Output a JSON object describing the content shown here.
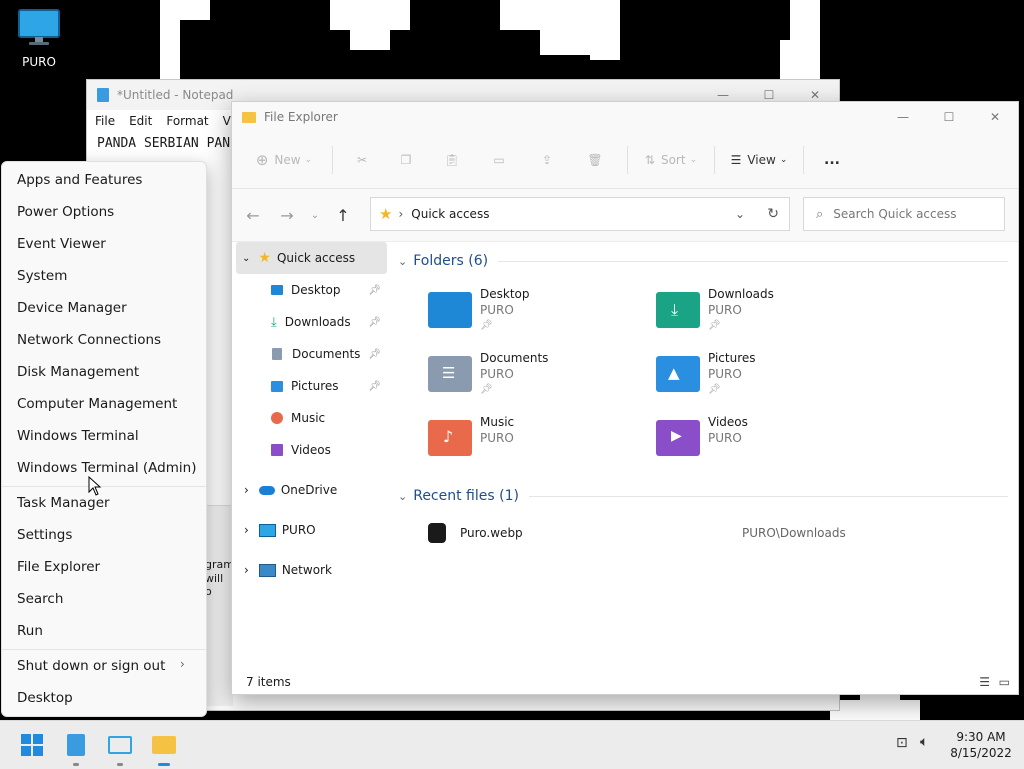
{
  "desktop": {
    "icon_label": "PURO"
  },
  "notepad": {
    "title": "*Untitled - Notepad",
    "menu": [
      "File",
      "Edit",
      "Format",
      "View"
    ],
    "text": "PANDA SERBIAN PAN",
    "behind_text_1": "gram,",
    "behind_text_2": "will o"
  },
  "explorer": {
    "title": "File Explorer",
    "commands": {
      "new": "New",
      "sort": "Sort",
      "view": "View",
      "more": "..."
    },
    "address": "Quick access",
    "search_placeholder": "Search Quick access",
    "nav": {
      "quick_access": "Quick access",
      "items": [
        {
          "label": "Desktop",
          "pinned": true
        },
        {
          "label": "Downloads",
          "pinned": true
        },
        {
          "label": "Documents",
          "pinned": true
        },
        {
          "label": "Pictures",
          "pinned": true
        },
        {
          "label": "Music",
          "pinned": false
        },
        {
          "label": "Videos",
          "pinned": false
        }
      ],
      "onedrive": "OneDrive",
      "puro": "PURO",
      "network": "Network"
    },
    "folders_header": "Folders (6)",
    "folders": [
      {
        "name": "Desktop",
        "location": "PURO",
        "pinned": true,
        "color": "#1e88d6"
      },
      {
        "name": "Downloads",
        "location": "PURO",
        "pinned": true,
        "color": "#1aa384"
      },
      {
        "name": "Documents",
        "location": "PURO",
        "pinned": true,
        "color": "#8a9bb0"
      },
      {
        "name": "Pictures",
        "location": "PURO",
        "pinned": true,
        "color": "#2a8fe0"
      },
      {
        "name": "Music",
        "location": "PURO",
        "pinned": false,
        "color": "#e86a4a"
      },
      {
        "name": "Videos",
        "location": "PURO",
        "pinned": false,
        "color": "#8a4ec8"
      }
    ],
    "recent_header": "Recent files (1)",
    "recent": [
      {
        "name": "Puro.webp",
        "path": "PURO\\Downloads"
      }
    ],
    "status": "7 items"
  },
  "context_menu": {
    "group1": [
      "Apps and Features",
      "Power Options",
      "Event Viewer",
      "System",
      "Device Manager",
      "Network Connections",
      "Disk Management",
      "Computer Management",
      "Windows Terminal",
      "Windows Terminal (Admin)"
    ],
    "group2": [
      "Task Manager",
      "Settings",
      "File Explorer",
      "Search",
      "Run"
    ],
    "group3": [
      "Shut down or sign out",
      "Desktop"
    ]
  },
  "taskbar": {
    "time": "9:30 AM",
    "date": "8/15/2022"
  }
}
